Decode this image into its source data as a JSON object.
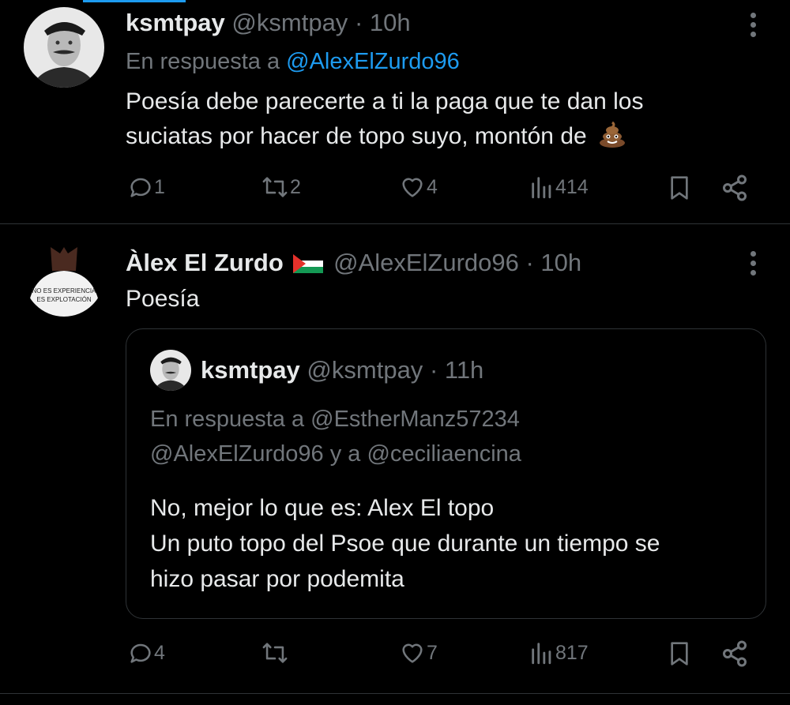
{
  "tweets": [
    {
      "name": "ksmtpay",
      "handle": "@ksmtpay",
      "time": "· 10h",
      "reply_prefix": "En respuesta a",
      "reply_handle": "@AlexElZurdo96",
      "text_lines": [
        "Poesía debe parecerte a ti la paga que te dan los",
        "suciatas por hacer de topo suyo, montón de"
      ],
      "emoji": "poop-emoji",
      "stats": {
        "replies": "1",
        "reposts": "2",
        "likes": "4",
        "views": "414"
      }
    },
    {
      "name": "Àlex El Zurdo",
      "flag": "palestine-flag",
      "handle": "@AlexElZurdo96",
      "time": "· 10h",
      "text": "Poesía",
      "avatar_text": [
        "NO ES EXPERIENCIA",
        "ES EXPLOTACIÓN"
      ],
      "quote": {
        "name": "ksmtpay",
        "handle": "@ksmtpay",
        "time": "· 11h",
        "reply_line1": "En respuesta a @EstherManz57234",
        "reply_line2": "@AlexElZurdo96 y a @ceciliaencina",
        "text_lines": [
          "No, mejor lo que es: Alex El topo",
          "Un puto topo del Psoe que durante un tiempo se",
          "hizo pasar por podemita"
        ]
      },
      "stats": {
        "replies": "4",
        "reposts": "",
        "likes": "7",
        "views": "817"
      }
    }
  ],
  "colors": {
    "background": "#000000",
    "text": "#e7e9ea",
    "muted": "#71767b",
    "link": "#1d9bf0",
    "border": "#2f3336"
  }
}
